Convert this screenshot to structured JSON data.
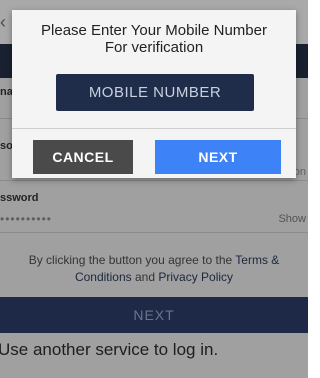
{
  "background": {
    "back_glyph": "‹",
    "label_email_fragment": "nai",
    "label_phone_fragment": "so",
    "label_password": "ssword",
    "password_mask": "••••••••••",
    "show_label": "Show",
    "fragment_on": "on",
    "terms_prefix": "By clicking the button you agree to the ",
    "terms_link": "Terms & Conditions",
    "terms_mid": " and ",
    "privacy_link": "Privacy Policy",
    "next_button": "NEXT",
    "another_service": "Use another service to log in."
  },
  "dialog": {
    "title": "Please Enter Your Mobile Number For verification",
    "mobile_placeholder": "MOBILE NUMBER",
    "cancel_label": "CANCEL",
    "next_label": "NEXT"
  }
}
